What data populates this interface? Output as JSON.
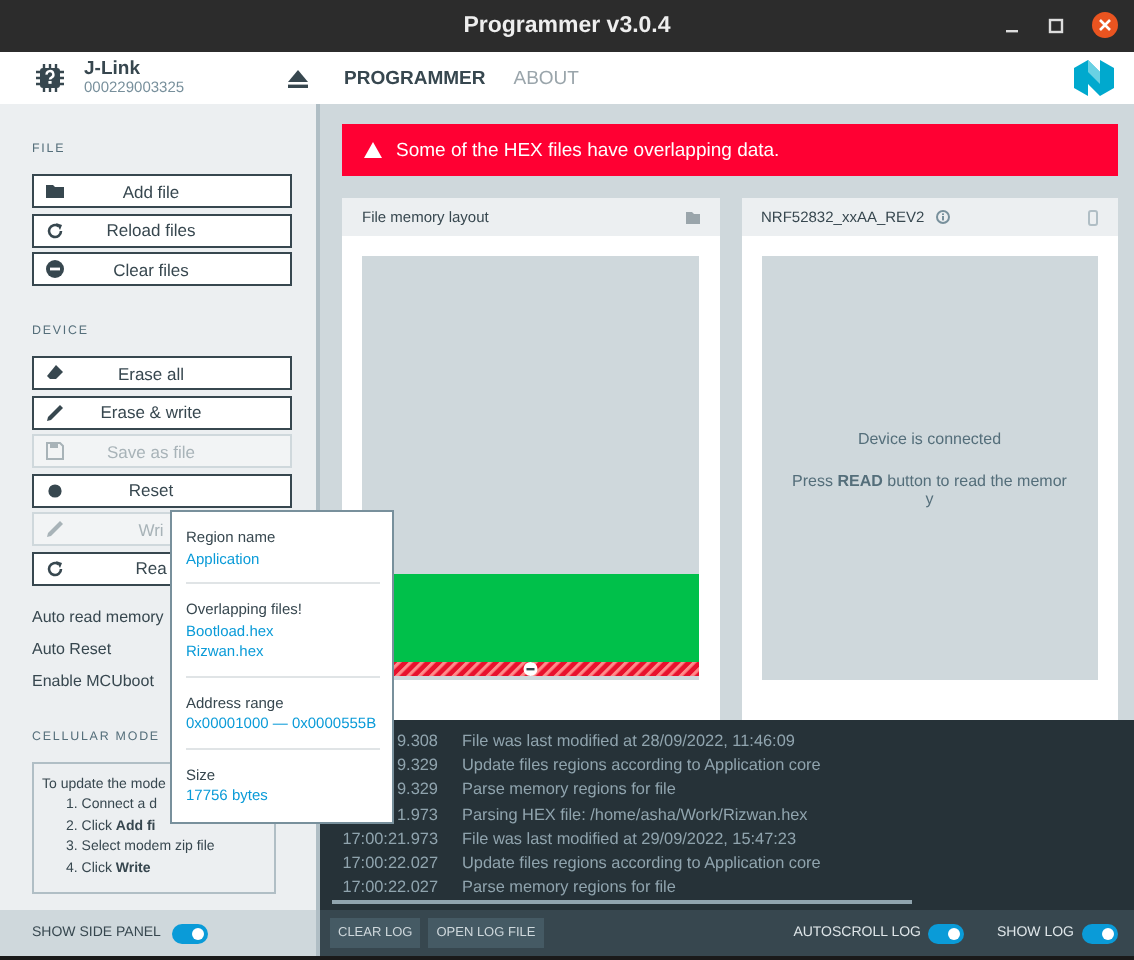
{
  "window": {
    "title": "Programmer v3.0.4"
  },
  "device": {
    "name": "J-Link",
    "serial": "000229003325"
  },
  "tabs": [
    {
      "label": "PROGRAMMER",
      "selected": true
    },
    {
      "label": "ABOUT",
      "selected": false
    }
  ],
  "sidebar": {
    "sections": [
      {
        "title": "FILE",
        "buttons": [
          {
            "label": "Add file",
            "disabled": false
          },
          {
            "label": "Reload files",
            "disabled": false
          },
          {
            "label": "Clear files",
            "disabled": false
          }
        ]
      },
      {
        "title": "DEVICE",
        "buttons": [
          {
            "label": "Erase all",
            "disabled": false
          },
          {
            "label": "Erase & write",
            "disabled": false
          },
          {
            "label": "Save as file",
            "disabled": true
          },
          {
            "label": "Reset",
            "disabled": false
          },
          {
            "label": "Wri",
            "disabled": true
          },
          {
            "label": "Rea",
            "disabled": false
          }
        ]
      }
    ],
    "options": [
      "Auto read memory",
      "Auto Reset",
      "Enable MCUboot"
    ],
    "cellular": {
      "title": "CELLULAR MODE",
      "intro": "To update the mode",
      "steps": [
        "1. Connect a d",
        "2. Click **Add fi**",
        "3. Select modem zip file",
        "4. Click **Write**"
      ]
    },
    "show_side_panel": {
      "label": "SHOW SIDE PANEL",
      "on": true
    }
  },
  "alert": {
    "text": "Some of the HEX files have overlapping data."
  },
  "file_card": {
    "title": "File memory layout"
  },
  "device_card": {
    "title": "NRF52832_xxAA_REV2",
    "status": "Device is connected",
    "hint": "Press **READ** button to read the memor y"
  },
  "tooltip": {
    "sections": [
      {
        "label": "Region name",
        "values": [
          "Application"
        ]
      },
      {
        "label": "Overlapping files!",
        "values": [
          "Bootload.hex",
          "Rizwan.hex"
        ]
      },
      {
        "label": "Address range",
        "values": [
          "0x00001000 — 0x0000555B"
        ]
      },
      {
        "label": "Size",
        "values": [
          "17756 bytes"
        ]
      }
    ]
  },
  "log": [
    {
      "time": "9.308",
      "message": "File was last modified at 28/09/2022, 11:46:09"
    },
    {
      "time": "9.329",
      "message": "Update files regions according to Application core"
    },
    {
      "time": "9.329",
      "message": "Parse memory regions for file"
    },
    {
      "time": "1.973",
      "message": "Parsing HEX file: /home/asha/Work/Rizwan.hex"
    },
    {
      "time": "17:00:21.973",
      "message": "File was last modified at 29/09/2022, 15:47:23"
    },
    {
      "time": "17:00:22.027",
      "message": "Update files regions according to Application core"
    },
    {
      "time": "17:00:22.027",
      "message": "Parse memory regions for file"
    }
  ],
  "log_bar": {
    "buttons": [
      "CLEAR LOG",
      "OPEN LOG FILE"
    ],
    "toggles": [
      {
        "label": "AUTOSCROLL LOG",
        "on": true
      },
      {
        "label": "SHOW LOG",
        "on": true
      }
    ]
  }
}
